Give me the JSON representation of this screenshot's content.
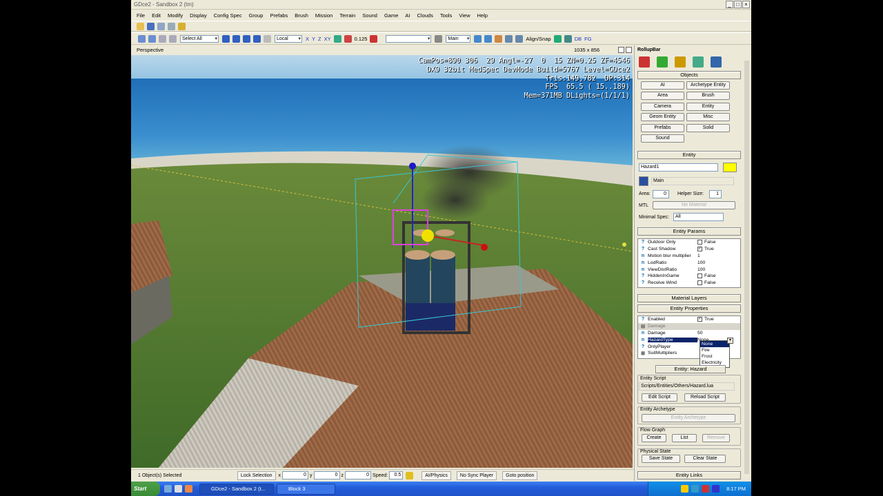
{
  "window": {
    "title": "GDce2 - Sandbox 2 (tm)",
    "minimize": "_",
    "maximize": "□",
    "close": "×"
  },
  "menu": [
    "File",
    "Edit",
    "Modify",
    "Display",
    "Config Spec",
    "Group",
    "Prefabs",
    "Brush",
    "Mission",
    "Terrain",
    "Sound",
    "Game",
    "AI",
    "Clouds",
    "Tools",
    "View",
    "Help"
  ],
  "toolbar": {
    "selection_filter": "Select All",
    "coord_system": "Local",
    "axes": [
      "X",
      "Y",
      "Z",
      "XY"
    ],
    "snap_value": "0.125",
    "layer": "Main",
    "align_snap": "Align/Snap",
    "db_labels": [
      "DB",
      "FG"
    ]
  },
  "viewport": {
    "name": "Perspective",
    "resolution": "1035 x 856",
    "hud": [
      "CamPos=890 306  29 Angl=-27  0  15 ZN=0.25 ZF=4546",
      "DX9 32bit MedSpec DevMode Build=5767 Level=GDce2",
      "Tris:149,782  DP:314",
      "FPS  65.5 ( 15..189)",
      "Mem=371MB DLights=(1/1/1)"
    ]
  },
  "statusbar": {
    "selected": "1 Object(s) Selected",
    "lock_selection": "Lock Selection",
    "x_label": "x",
    "x": "0",
    "y_label": "y",
    "y": "0",
    "z_label": "z",
    "z": "0",
    "speed_label": "Speed:",
    "speed": "0.5",
    "ai_physics": "AI/Physics",
    "no_sync_player": "No Sync Player",
    "goto_position": "Goto position"
  },
  "rollup": {
    "title": "RollupBar",
    "objects_header": "Objects",
    "object_buttons": [
      "AI",
      "Archetype Entity",
      "Area",
      "Brush",
      "Camera",
      "Entity",
      "Geom Entity",
      "Misc",
      "Prefabs",
      "Solid",
      "Sound"
    ],
    "entity_header": "Entity",
    "entity_name": "Hazard1",
    "entity_color": "#ffff00",
    "layer_label": "Main",
    "area_label": "Area:",
    "area_value": "0",
    "helper_size_label": "Helper Size:",
    "helper_size_value": "1",
    "mtl_label": "MTL",
    "mtl_button": "No Material",
    "min_spec_label": "Minimal Spec:",
    "min_spec_value": "All",
    "entity_params_header": "Entity Params",
    "entity_params": [
      {
        "k": "?",
        "name": "Outdoor Only",
        "check": "",
        "value": "False"
      },
      {
        "k": "?",
        "name": "Cast Shadow",
        "check": "✓",
        "value": "True"
      },
      {
        "k": "n",
        "name": "Motion blur multiplier",
        "check": "",
        "value": "1"
      },
      {
        "k": "n",
        "name": "LodRatio",
        "check": "",
        "value": "100"
      },
      {
        "k": "n",
        "name": "ViewDistRatio",
        "check": "",
        "value": "100"
      },
      {
        "k": "?",
        "name": "HiddenInGame",
        "check": "",
        "value": "False"
      },
      {
        "k": "?",
        "name": "Receive Wind",
        "check": "",
        "value": "False"
      }
    ],
    "material_layers_header": "Material Layers",
    "entity_properties_header": "Entity Properties",
    "entity_properties": [
      {
        "k": "?",
        "name": "Enabled",
        "check": "✓",
        "value": "True"
      },
      {
        "k": "⊟",
        "name": "Damage",
        "check": "",
        "value": ""
      },
      {
        "k": "n",
        "name": "Damage",
        "check": "",
        "value": "50"
      },
      {
        "k": "n",
        "name": "HazardType",
        "check": "",
        "value": "None"
      },
      {
        "k": "?",
        "name": "OnlyPlayer",
        "check": "",
        "value": ""
      },
      {
        "k": "⊞",
        "name": "SuitMultipliers",
        "check": "",
        "value": ""
      }
    ],
    "hazard_dropdown": [
      "None",
      "Fire",
      "Frost",
      "Electricity"
    ],
    "entity_hazard_header": "Entity: Hazard",
    "entity_script_label": "Entity Script",
    "entity_script_path": "Scripts/Entities/Others/Hazard.lua",
    "edit_script": "Edit Script",
    "reload_script": "Reload Script",
    "entity_archetype_label": "Entity Archetype",
    "entity_archetype_button": "Entity Archetype",
    "flow_graph_label": "Flow Graph",
    "create": "Create",
    "list": "List",
    "remove": "Remove",
    "physical_state_label": "Physical State",
    "save_state": "Save State",
    "clear_state": "Clear State",
    "entity_links_header": "Entity Links"
  },
  "taskbar": {
    "start": "Start",
    "tasks": [
      "GDce2 - Sandbox 2 (t...",
      "Block 3"
    ],
    "clock": "8:17 PM"
  }
}
